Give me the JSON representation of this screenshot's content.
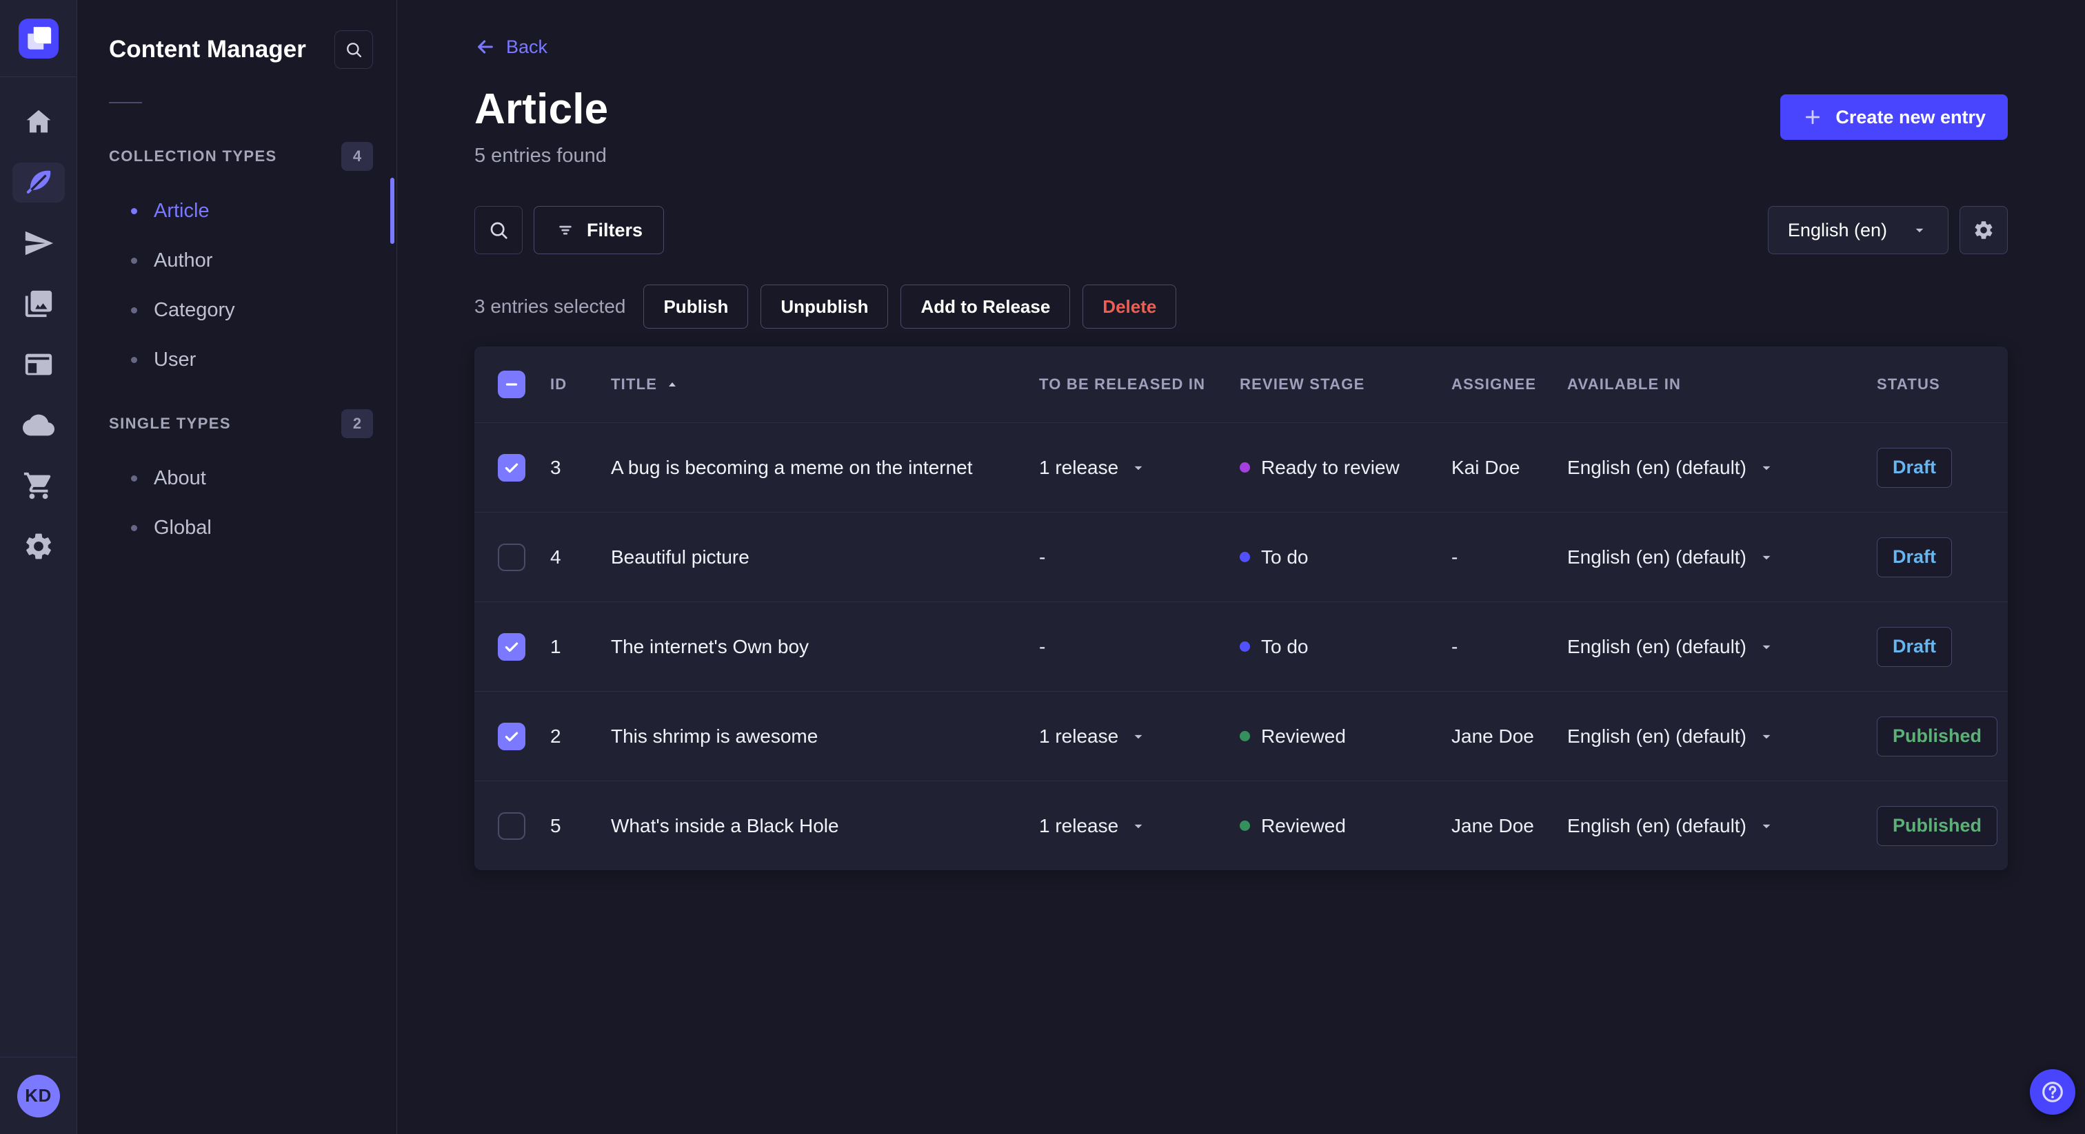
{
  "colors": {
    "accent": "#4945ff",
    "accent_light": "#7b79ff",
    "danger": "#ee5e52",
    "success": "#5cb176",
    "draft_blue": "#66b7f1",
    "surface": "#212134",
    "background": "#181826"
  },
  "rail": {
    "items": [
      {
        "icon": "home",
        "name": "home",
        "active": false
      },
      {
        "icon": "feather",
        "name": "content-manager",
        "active": true
      },
      {
        "icon": "send",
        "name": "releases",
        "active": false
      },
      {
        "icon": "images",
        "name": "media-library",
        "active": false
      },
      {
        "icon": "layout",
        "name": "content-type-builder",
        "active": false
      },
      {
        "icon": "cloud",
        "name": "deploy",
        "active": false
      },
      {
        "icon": "cart",
        "name": "marketplace",
        "active": false
      },
      {
        "icon": "gear",
        "name": "settings",
        "active": false
      }
    ],
    "avatar_initials": "KD"
  },
  "sidebar": {
    "title": "Content Manager",
    "sections": [
      {
        "label": "COLLECTION TYPES",
        "count": "4",
        "items": [
          {
            "label": "Article",
            "active": true
          },
          {
            "label": "Author",
            "active": false
          },
          {
            "label": "Category",
            "active": false
          },
          {
            "label": "User",
            "active": false
          }
        ]
      },
      {
        "label": "SINGLE TYPES",
        "count": "2",
        "items": [
          {
            "label": "About",
            "active": false
          },
          {
            "label": "Global",
            "active": false
          }
        ]
      }
    ]
  },
  "header": {
    "back_label": "Back",
    "title": "Article",
    "subtitle": "5 entries found",
    "create_button_label": "Create new entry"
  },
  "toolbar": {
    "filters_label": "Filters",
    "locale_selected": "English (en)"
  },
  "selection": {
    "text": "3 entries selected",
    "actions": [
      {
        "label": "Publish",
        "variant": "default"
      },
      {
        "label": "Unpublish",
        "variant": "default"
      },
      {
        "label": "Add to Release",
        "variant": "default"
      },
      {
        "label": "Delete",
        "variant": "danger"
      }
    ]
  },
  "table": {
    "header_checkbox": "indeterminate",
    "columns": [
      {
        "label": "ID",
        "sorted": ""
      },
      {
        "label": "TITLE",
        "sorted": "asc"
      },
      {
        "label": "TO BE RELEASED IN",
        "sorted": ""
      },
      {
        "label": "REVIEW STAGE",
        "sorted": ""
      },
      {
        "label": "ASSIGNEE",
        "sorted": ""
      },
      {
        "label": "AVAILABLE IN",
        "sorted": ""
      },
      {
        "label": "STATUS",
        "sorted": ""
      }
    ],
    "rows": [
      {
        "checked": true,
        "id": "3",
        "title": "A bug is becoming a meme on the internet",
        "release": "1 release",
        "release_dropdown": true,
        "review": {
          "label": "Ready to review",
          "color": "#a53fe0"
        },
        "assignee": "Kai Doe",
        "locale": "English (en) (default)",
        "status": {
          "label": "Draft",
          "color": "#66b7f1"
        }
      },
      {
        "checked": false,
        "id": "4",
        "title": "Beautiful picture",
        "release": "-",
        "release_dropdown": false,
        "review": {
          "label": "To do",
          "color": "#5151ff"
        },
        "assignee": "-",
        "locale": "English (en) (default)",
        "status": {
          "label": "Draft",
          "color": "#66b7f1"
        }
      },
      {
        "checked": true,
        "id": "1",
        "title": "The internet's Own boy",
        "release": "-",
        "release_dropdown": false,
        "review": {
          "label": "To do",
          "color": "#5151ff"
        },
        "assignee": "-",
        "locale": "English (en) (default)",
        "status": {
          "label": "Draft",
          "color": "#66b7f1"
        }
      },
      {
        "checked": true,
        "id": "2",
        "title": "This shrimp is awesome",
        "release": "1 release",
        "release_dropdown": true,
        "review": {
          "label": "Reviewed",
          "color": "#35915c"
        },
        "assignee": "Jane Doe",
        "locale": "English (en) (default)",
        "status": {
          "label": "Published",
          "color": "#5cb176"
        }
      },
      {
        "checked": false,
        "id": "5",
        "title": "What's inside a Black Hole",
        "release": "1 release",
        "release_dropdown": true,
        "review": {
          "label": "Reviewed",
          "color": "#35915c"
        },
        "assignee": "Jane Doe",
        "locale": "English (en) (default)",
        "status": {
          "label": "Published",
          "color": "#5cb176"
        }
      }
    ]
  }
}
